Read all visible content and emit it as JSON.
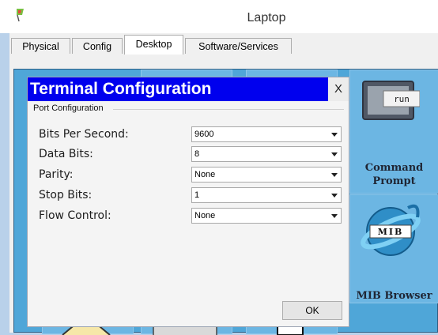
{
  "window": {
    "title": "Laptop"
  },
  "tabs": [
    {
      "label": "Physical"
    },
    {
      "label": "Config"
    },
    {
      "label": "Desktop"
    },
    {
      "label": "Software/Services"
    }
  ],
  "desktop": {
    "tiles": [
      {
        "label_line1": "Command",
        "label_line2": "Prompt",
        "icon": "terminal-icon",
        "icon_text": "run"
      },
      {
        "label_line1": "MIB Browser",
        "icon": "mib-browser-icon",
        "icon_text": "MIB"
      }
    ]
  },
  "dialog": {
    "title": "Terminal Configuration",
    "close": "X",
    "group": "Port Configuration",
    "fields": [
      {
        "label": "Bits Per Second:",
        "value": "9600"
      },
      {
        "label": "Data Bits:",
        "value": "8"
      },
      {
        "label": "Parity:",
        "value": "None"
      },
      {
        "label": "Stop Bits:",
        "value": "1"
      },
      {
        "label": "Flow Control:",
        "value": "None"
      }
    ],
    "ok_label": "OK"
  }
}
